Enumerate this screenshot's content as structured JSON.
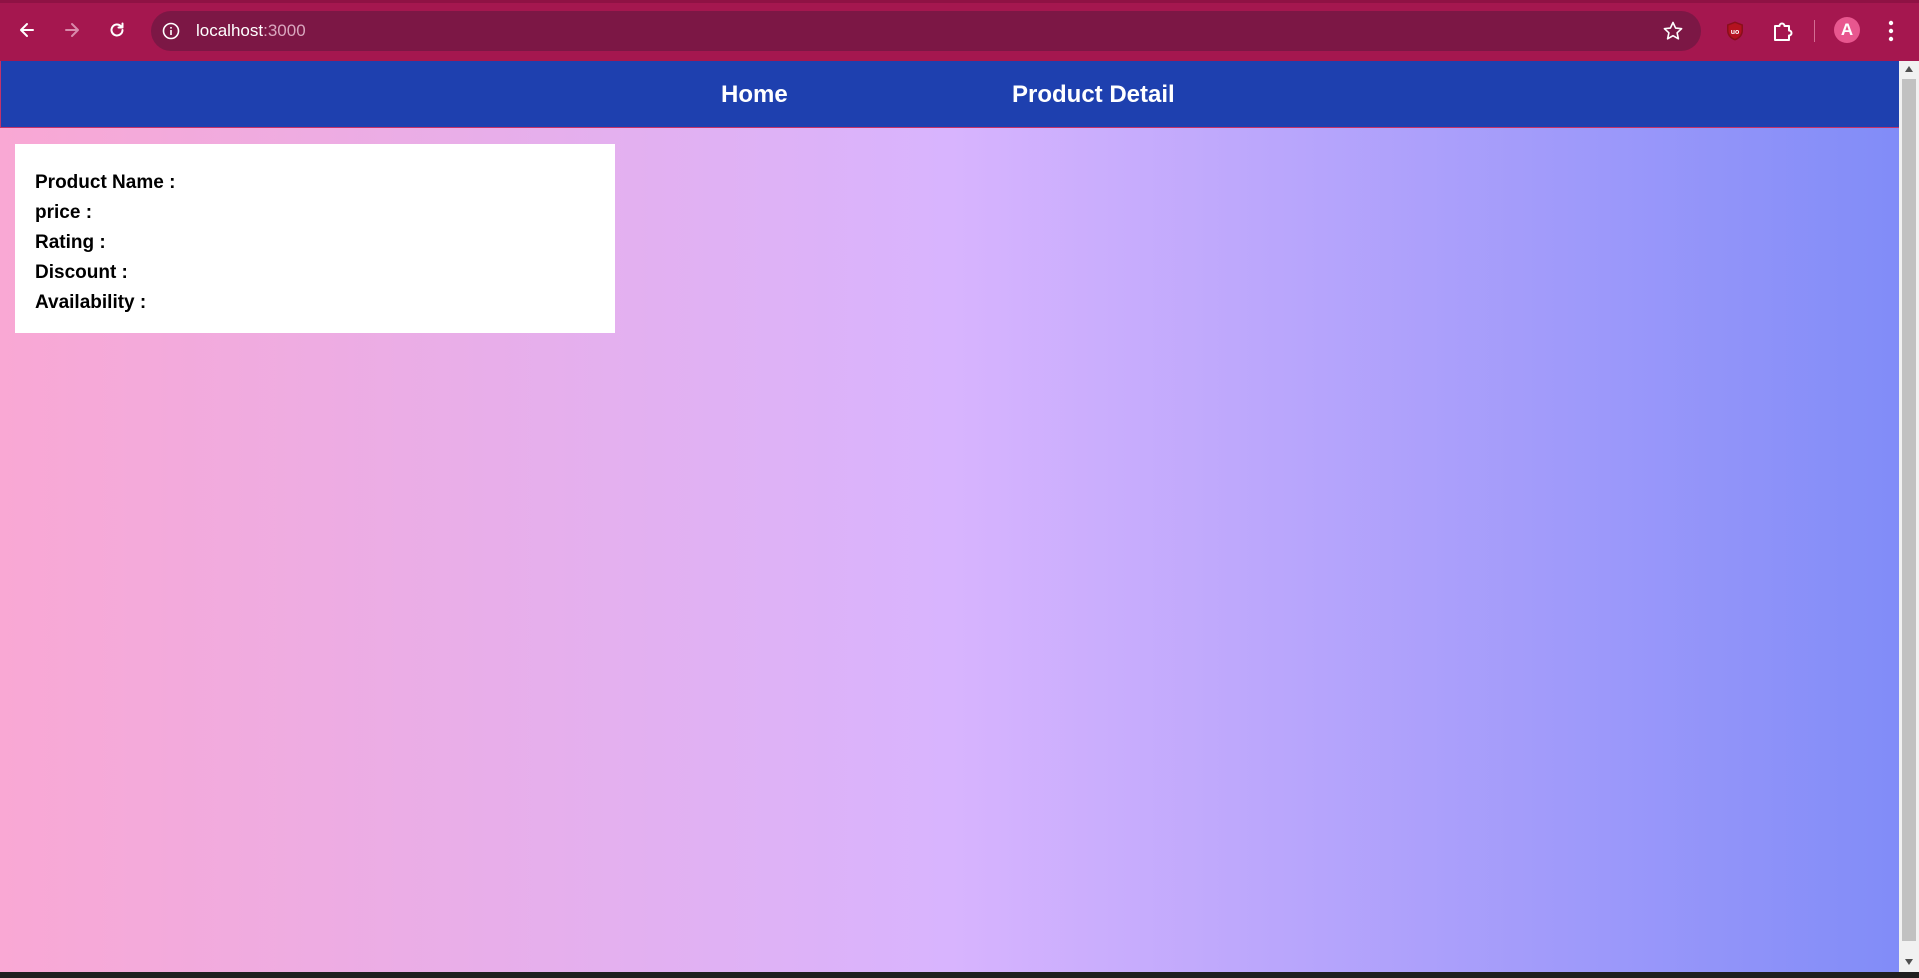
{
  "browser": {
    "url_host": "localhost",
    "url_port": ":3000",
    "avatar_letter": "A",
    "accent_color": "#a5174f",
    "icons": [
      "back-arrow-icon",
      "forward-arrow-icon",
      "reload-icon",
      "site-info-icon",
      "bookmark-star-icon",
      "ublock-icon",
      "extensions-puzzle-icon",
      "kebab-menu-icon"
    ]
  },
  "navbar": {
    "home_label": "Home",
    "product_detail_label": "Product Detail",
    "background": "#1e40af"
  },
  "product_card": {
    "name_label": "Product Name :",
    "price_label": "price :",
    "rating_label": "Rating :",
    "discount_label": "Discount :",
    "availability_label": "Availability :"
  },
  "page": {
    "gradient_colors": [
      "#f9a8d4",
      "#d8b4fe",
      "#818cf8"
    ]
  }
}
